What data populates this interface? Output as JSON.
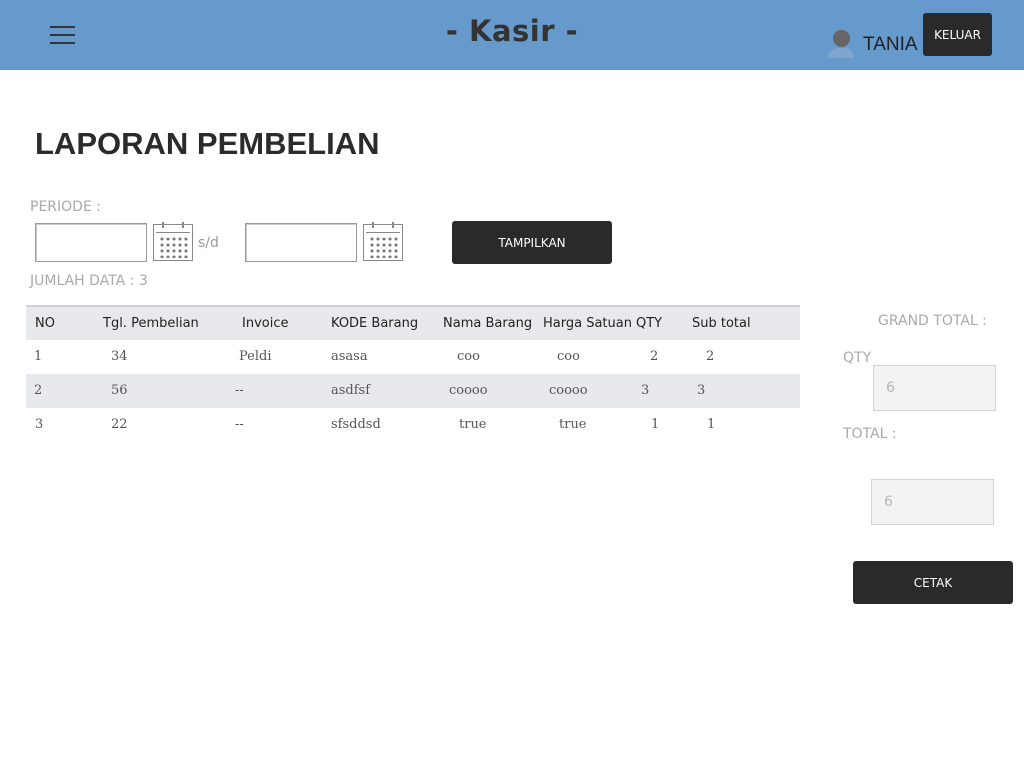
{
  "header": {
    "title": "- Kasir -",
    "user_name": "TANIA",
    "logout_label": "KELUAR",
    "bar_color": "#6699cc"
  },
  "report": {
    "title": "LAPORAN PEMBELIAN",
    "periode_label": "PERIODE :",
    "date_from": "",
    "date_to": "",
    "separator": "s/d",
    "show_button": "TAMPILKAN",
    "jumlah_label": "JUMLAH DATA : 3"
  },
  "table": {
    "headers": [
      "NO",
      "Tgl. Pembelian",
      "Invoice",
      "KODE Barang",
      "Nama Barang",
      "Harga Satuan",
      "QTY",
      "Sub total"
    ],
    "rows": [
      [
        "1",
        "34",
        "Peldi",
        "asasa",
        "coo",
        "coo",
        "2",
        "2"
      ],
      [
        "2",
        "56",
        "--",
        "asdfsf",
        "coooo",
        "coooo",
        "3",
        "3"
      ],
      [
        "3",
        "22",
        "--",
        "sfsddsd",
        "true",
        "true",
        "1",
        "1"
      ]
    ]
  },
  "summary": {
    "grand_total_label": "GRAND TOTAL :",
    "qty_label": "QTY",
    "qty_value": "6",
    "total_label": "TOTAL :",
    "total_value": "6",
    "print_button": "CETAK"
  },
  "icons": {
    "menu": "hamburger-menu-icon",
    "user": "user-avatar-icon",
    "calendar": "calendar-icon"
  }
}
